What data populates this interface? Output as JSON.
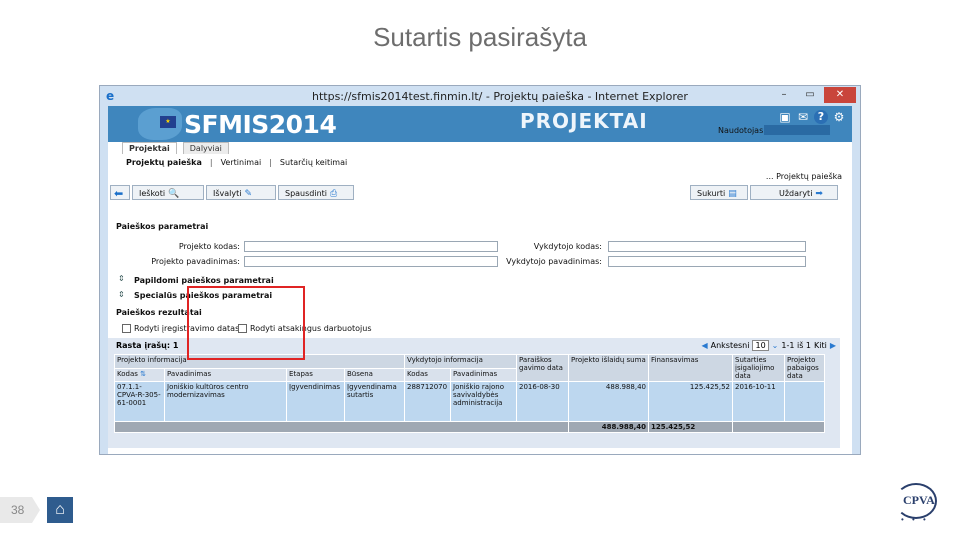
{
  "slide": {
    "title": "Sutartis pasirašyta",
    "page_number": "38"
  },
  "browser": {
    "title": "https://sfmis2014test.finmin.lt/ - Projektų paieška - Internet Explorer",
    "window_buttons": [
      "–",
      "▭",
      "✕"
    ]
  },
  "app": {
    "brand": "SFMIS2014",
    "module_title": "PROJEKTAI",
    "user_label": "Naudotojas:",
    "tabs": [
      "Projektai",
      "Dalyviai"
    ],
    "menu": [
      "Projektų paieška",
      "Vertinimai",
      "Sutarčių keitimai"
    ],
    "breadcrumb": "... Projektų paieška",
    "toolbar": {
      "search": "Ieškoti",
      "clear": "Išvalyti",
      "print": "Spausdinti",
      "create": "Sukurti",
      "close": "Uždaryti"
    },
    "search_params": {
      "heading": "Paieškos parametrai",
      "project_code": "Projekto kodas:",
      "project_name": "Projekto pavadinimas:",
      "executor_code": "Vykdytojo kodas:",
      "executor_name": "Vykdytojo pavadinimas:",
      "additional": "Papildomi paieškos parametrai",
      "special": "Specialūs paieškos parametrai"
    },
    "results": {
      "heading": "Paieškos rezultatai",
      "show_registration": "Rodyti įregistravimo datas",
      "show_rejected": "Rodyti atsakingus darbuotojus",
      "found": "Rasta įrašų: 1",
      "pager_prev": "Ankstesni",
      "page_size": "10",
      "range": "1-1 iš 1",
      "next": "Kiti"
    },
    "table": {
      "group_project": "Projekto informacija",
      "group_executor": "Vykdytojo informacija",
      "col_submit_date": "Paraiškos gavimo data",
      "col_costs": "Projekto išlaidų suma",
      "col_financing": "Finansavimas",
      "col_effective_date": "Sutarties įsigaliojimo data",
      "col_end_date": "Projekto pabaigos data",
      "col_code": "Kodas",
      "col_name": "Pavadinimas",
      "col_stage": "Etapas",
      "col_status": "Būsena",
      "col_exec_code": "Kodas",
      "col_exec_name": "Pavadinimas",
      "row": {
        "code": "07.1.1-CPVA-R-305-61-0001",
        "name": "Joniškio kultūros centro modernizavimas",
        "stage": "Įgyvendinimas",
        "status": "Įgyvendinama sutartis",
        "exec_code": "288712070",
        "exec_name": "Joniškio rajono savivaldybės administracija",
        "submit_date": "2016-08-30",
        "costs": "488.988,40",
        "financing": "125.425,52",
        "effective_date": "2016-10-11"
      },
      "total": {
        "costs": "488.988,40",
        "financing": "125.425,52"
      }
    }
  },
  "logo": {
    "text": "CPVA",
    "color": "#2a3f6c"
  },
  "colors": {
    "banner": "#3f86bd",
    "highlight": "#e02424",
    "home_button": "#2f5c8e"
  }
}
